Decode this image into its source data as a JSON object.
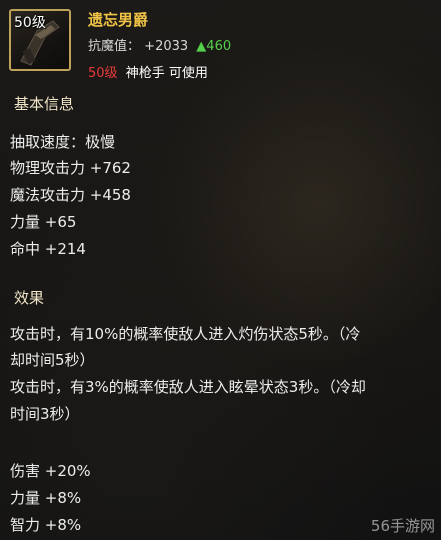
{
  "item": {
    "level": "50级",
    "name": "遗忘男爵",
    "stat_label": "抗魔值",
    "stat_value": "+2033",
    "stat_increase": "▲460",
    "req_level": "50级",
    "req_class": "神枪手 可使用"
  },
  "basic_info": {
    "title": "基本信息",
    "attributes": [
      "抽取速度：极慢",
      "物理攻击力 +762",
      "魔法攻击力 +458",
      "力量 +65",
      "命中 +214"
    ]
  },
  "effects": {
    "title": "效果",
    "lines": [
      "攻击时，有10%的概率使敌人进入灼伤状态5秒。（冷",
      "却时间5秒）",
      "攻击时，有3%的概率使敌人进入眩晕状态3秒。（冷却",
      "时间3秒）"
    ],
    "bonuses": [
      "伤害 +20%",
      "力量 +8%",
      "智力 +8%"
    ]
  },
  "watermark": "56手游网",
  "colors": {
    "item_name": "#f0c246",
    "increase": "#55d04a",
    "required_level": "#e83a3a",
    "icon_border": "#bfa35a"
  }
}
